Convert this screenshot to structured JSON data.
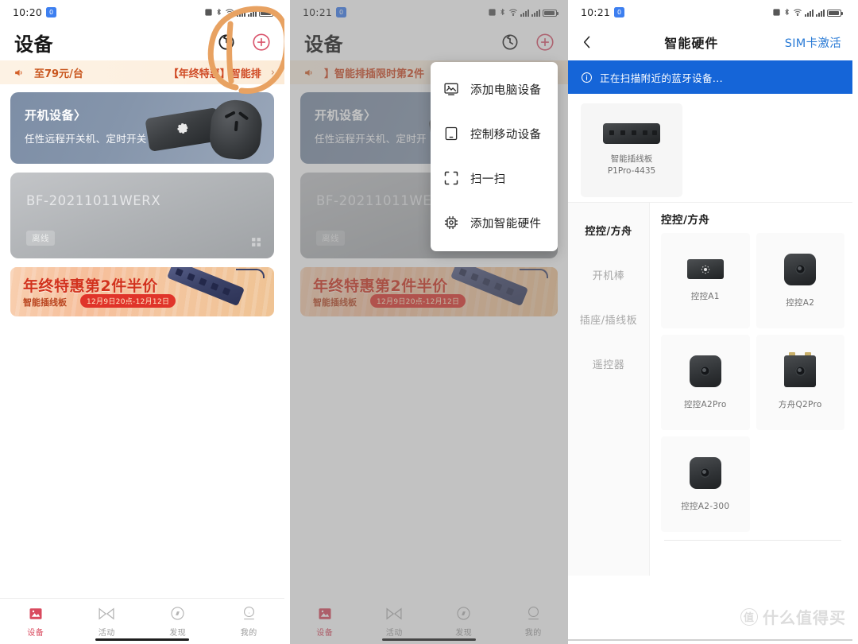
{
  "panel1": {
    "status": {
      "time": "10:20",
      "badge_label": "0"
    },
    "header": {
      "title": "设备",
      "history_icon": "history-clock-icon",
      "add_icon": "plus-circle-icon"
    },
    "ad": {
      "speaker_icon": "speaker-icon",
      "price": "至79元/台",
      "text": "【年终特惠】智能排",
      "arrow": "›"
    },
    "promo_card": {
      "title": "开机设备〉",
      "subtitle": "任性远程开关机、定时开关"
    },
    "device_card": {
      "name": "BF-20211011WERX",
      "status_badge": "离线",
      "menu_icon": "grid-dots-icon"
    },
    "banner": {
      "title": "年终特惠第2件半价",
      "subtitle": "智能插线板",
      "date": "12月9日20点-12月12日"
    },
    "tabs": [
      {
        "label": "设备",
        "icon": "devices-icon",
        "active": true
      },
      {
        "label": "活动",
        "icon": "activity-icon",
        "active": false
      },
      {
        "label": "发现",
        "icon": "compass-icon",
        "active": false
      },
      {
        "label": "我的",
        "icon": "person-icon",
        "active": false
      }
    ],
    "annotation": "orange-highlight-circle"
  },
  "panel2": {
    "status": {
      "time": "10:21",
      "badge_label": "0"
    },
    "header": {
      "title": "设备",
      "history_icon": "history-clock-icon",
      "add_icon": "plus-circle-icon"
    },
    "ad": {
      "speaker_icon": "speaker-icon",
      "text": "】智能排插限时第2件"
    },
    "promo_card": {
      "title": "开机设备〉",
      "subtitle": "任性远程开关机、定时开"
    },
    "device_card": {
      "name": "BF-20211011WERX",
      "status_badge": "离线"
    },
    "banner": {
      "title": "年终特惠第2件半价",
      "subtitle": "智能插线板",
      "date": "12月9日20点-12月12日"
    },
    "menu": [
      {
        "label": "添加电脑设备",
        "icon": "monitor-image-icon"
      },
      {
        "label": "控制移动设备",
        "icon": "mobile-device-icon"
      },
      {
        "label": "扫一扫",
        "icon": "scan-qr-icon"
      },
      {
        "label": "添加智能硬件",
        "icon": "chip-icon"
      }
    ],
    "tabs": [
      {
        "label": "设备",
        "icon": "devices-icon",
        "active": true
      },
      {
        "label": "活动",
        "icon": "activity-icon",
        "active": false
      },
      {
        "label": "发现",
        "icon": "compass-icon",
        "active": false
      },
      {
        "label": "我的",
        "icon": "person-icon",
        "active": false
      }
    ]
  },
  "panel3": {
    "status": {
      "time": "10:21",
      "badge_label": "0"
    },
    "nav": {
      "back_icon": "chevron-left-icon",
      "title": "智能硬件",
      "action": "SIM卡激活"
    },
    "scan_banner": {
      "icon": "info-circle-icon",
      "text": "正在扫描附近的蓝牙设备..."
    },
    "found_device": {
      "name_line1": "智能插线板",
      "name_line2": "P1Pro-4435"
    },
    "categories": [
      {
        "label": "控控/方舟",
        "active": true
      },
      {
        "label": "开机棒",
        "active": false
      },
      {
        "label": "插座/插线板",
        "active": false
      },
      {
        "label": "遥控器",
        "active": false
      }
    ],
    "products_heading": "控控/方舟",
    "products": [
      {
        "name": "控控A1",
        "shape": "rect"
      },
      {
        "name": "控控A2",
        "shape": "square"
      },
      {
        "name": "控控A2Pro",
        "shape": "square"
      },
      {
        "name": "方舟Q2Pro",
        "shape": "sharp"
      },
      {
        "name": "控控A2-300",
        "shape": "square"
      }
    ],
    "watermark": {
      "mark": "值",
      "text": "什么值得买"
    }
  },
  "colors": {
    "accent_red": "#d94a5e",
    "promo_orange": "#cf4a24",
    "scan_blue": "#1565d8",
    "link_blue": "#2a7bd6",
    "annotation_orange": "#e8a262"
  }
}
